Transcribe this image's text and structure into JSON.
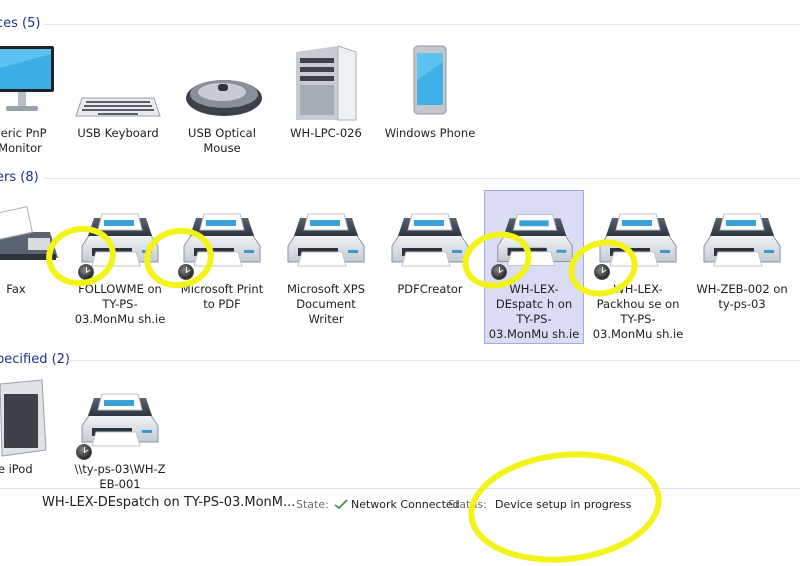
{
  "sections": {
    "devices": "ces (5)",
    "printers": "ers (8)",
    "unspecified": "pecified (2)"
  },
  "devices": [
    {
      "label": "neric PnP Monitor",
      "icon": "monitor-icon"
    },
    {
      "label": "USB Keyboard",
      "icon": "keyboard-icon"
    },
    {
      "label": "USB Optical Mouse",
      "icon": "mouse-icon"
    },
    {
      "label": "WH-LPC-026",
      "icon": "computer-tower-icon"
    },
    {
      "label": "Windows Phone",
      "icon": "phone-icon"
    }
  ],
  "printers": [
    {
      "label": "Fax",
      "icon": "fax-icon"
    },
    {
      "label": "FOLLOWME on TY-PS-03.MonMu sh.ie",
      "icon": "printer-icon"
    },
    {
      "label": "Microsoft Print to PDF",
      "icon": "printer-icon"
    },
    {
      "label": "Microsoft XPS Document Writer",
      "icon": "printer-icon"
    },
    {
      "label": "PDFCreator",
      "icon": "printer-icon"
    },
    {
      "label": "WH-LEX-DEspatc h on TY-PS-03.MonMu sh.ie",
      "icon": "printer-icon"
    },
    {
      "label": "WH-LEX-Packhou se on TY-PS-03.MonMu sh.ie",
      "icon": "printer-icon"
    },
    {
      "label": "WH-ZEB-002 on ty-ps-03",
      "icon": "printer-icon"
    }
  ],
  "unspecified": [
    {
      "label": "ple iPod",
      "icon": "ipod-icon"
    },
    {
      "label": "\\\\ty-ps-03\\WH-Z EB-001",
      "icon": "printer-icon"
    }
  ],
  "details": {
    "name": "WH-LEX-DEspatch on TY-PS-03.MonM...",
    "state_label": "State:",
    "state_value": "Network Connected",
    "status_label": "Status:",
    "status_value": "Device setup in progress"
  },
  "colors": {
    "section_header": "#1e3287",
    "selection": "#dadcf6",
    "highlight": "#f3f31a"
  }
}
